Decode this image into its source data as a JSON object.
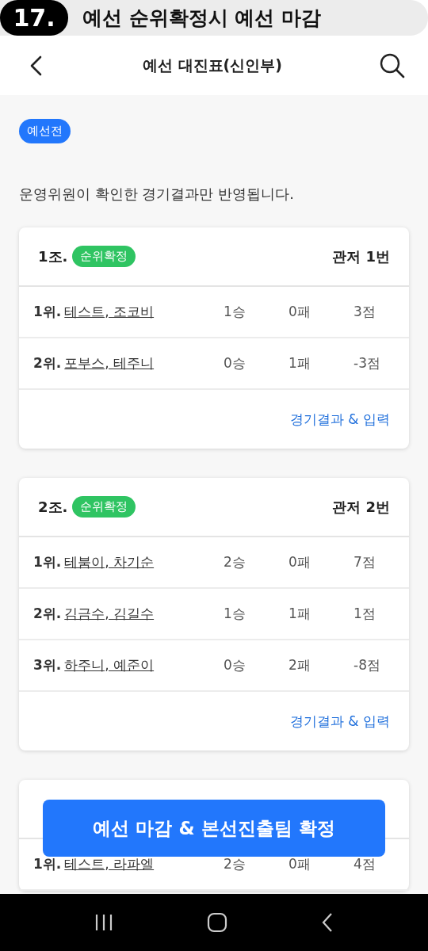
{
  "banner": {
    "number": "17.",
    "title": "예선 순위확정시 예선 마감"
  },
  "app_bar": {
    "title": "예선 대진표(신인부)"
  },
  "stage_chip": "예선전",
  "notice": "운영위원이 확인한 경기결과만 반영됩니다.",
  "groups": [
    {
      "label": "1조.",
      "status": "순위확정",
      "court": "관저 1번",
      "rows": [
        {
          "rank": "1위.",
          "team": "테스트, 조코비",
          "wins": "1승",
          "losses": "0패",
          "points": "3점"
        },
        {
          "rank": "2위.",
          "team": "포부스, 테주니",
          "wins": "0승",
          "losses": "1패",
          "points": "-3점"
        }
      ],
      "action": "경기결과 & 입력"
    },
    {
      "label": "2조.",
      "status": "순위확정",
      "court": "관저 2번",
      "rows": [
        {
          "rank": "1위.",
          "team": "테붐이, 차기순",
          "wins": "2승",
          "losses": "0패",
          "points": "7점"
        },
        {
          "rank": "2위.",
          "team": "김금수, 김길수",
          "wins": "1승",
          "losses": "1패",
          "points": "1점"
        },
        {
          "rank": "3위.",
          "team": "하주니, 예준이",
          "wins": "0승",
          "losses": "2패",
          "points": "-8점"
        }
      ],
      "action": "경기결과 & 입력"
    },
    {
      "rows": [
        {
          "rank": "1위.",
          "team": "테스트, 라파엘",
          "wins": "2승",
          "losses": "0패",
          "points": "4점"
        }
      ]
    }
  ],
  "primary_button": "예선 마감 & 본선진출팀 확정"
}
